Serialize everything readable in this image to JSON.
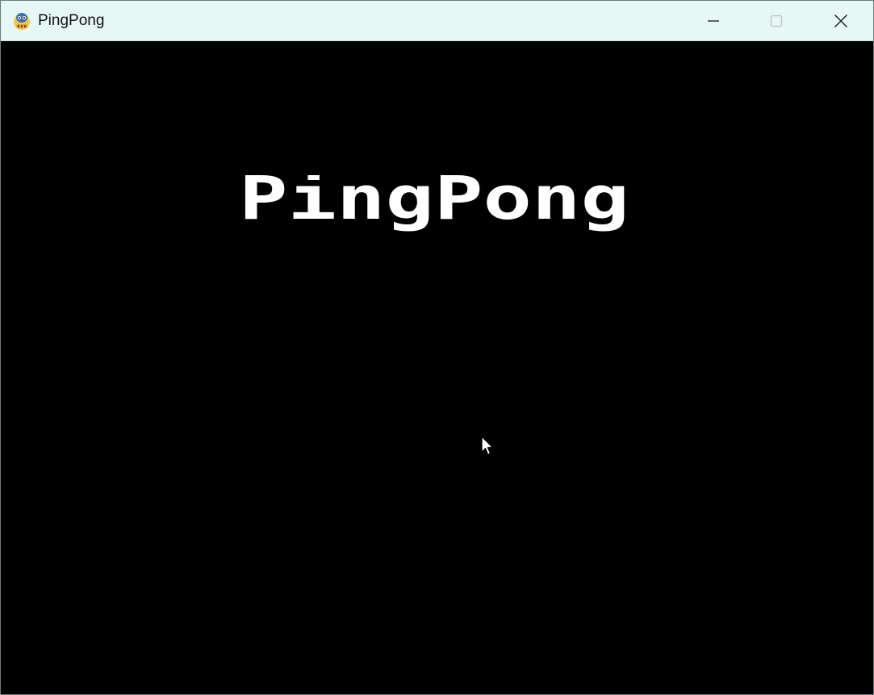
{
  "window": {
    "title": "PingPong",
    "app_icon": "pygame-snake-icon"
  },
  "controls": {
    "minimize_icon": "minimize-icon",
    "maximize_icon": "maximize-icon",
    "close_icon": "close-icon"
  },
  "game": {
    "title": "PingPong",
    "background_color": "#000000",
    "text_color": "#ffffff"
  }
}
